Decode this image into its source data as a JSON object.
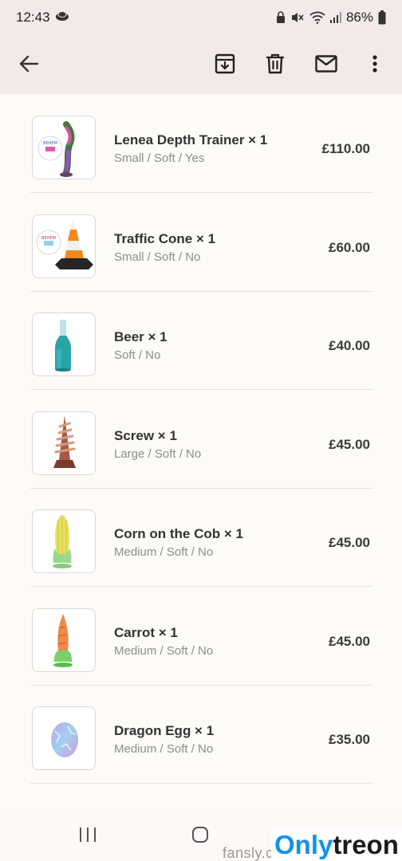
{
  "status_bar": {
    "time": "12:43",
    "battery": "86%"
  },
  "app_bar": {
    "icons": [
      "back-arrow-icon",
      "archive-icon",
      "trash-icon",
      "mail-icon",
      "more-vert-icon"
    ]
  },
  "items": [
    {
      "title": "Lenea Depth Trainer × 1",
      "options": "Small / Soft / Yes",
      "price": "£110.00"
    },
    {
      "title": "Traffic Cone × 1",
      "options": "Small / Soft / No",
      "price": "£60.00"
    },
    {
      "title": "Beer × 1",
      "options": "Soft / No",
      "price": "£40.00"
    },
    {
      "title": "Screw × 1",
      "options": "Large / Soft / No",
      "price": "£45.00"
    },
    {
      "title": "Corn on the Cob × 1",
      "options": "Medium / Soft / No",
      "price": "£45.00"
    },
    {
      "title": "Carrot × 1",
      "options": "Medium / Soft / No",
      "price": "£45.00"
    },
    {
      "title": "Dragon Egg × 1",
      "options": "Medium / Soft / No",
      "price": "£35.00"
    }
  ],
  "footer": {
    "site_text": "fansly.c",
    "watermark_a": "Only",
    "watermark_b": "treon"
  },
  "colors": {
    "header_bg": "#f2eae8",
    "card_bg": "#fdfbfa",
    "watermark_blue": "#1591e6"
  }
}
